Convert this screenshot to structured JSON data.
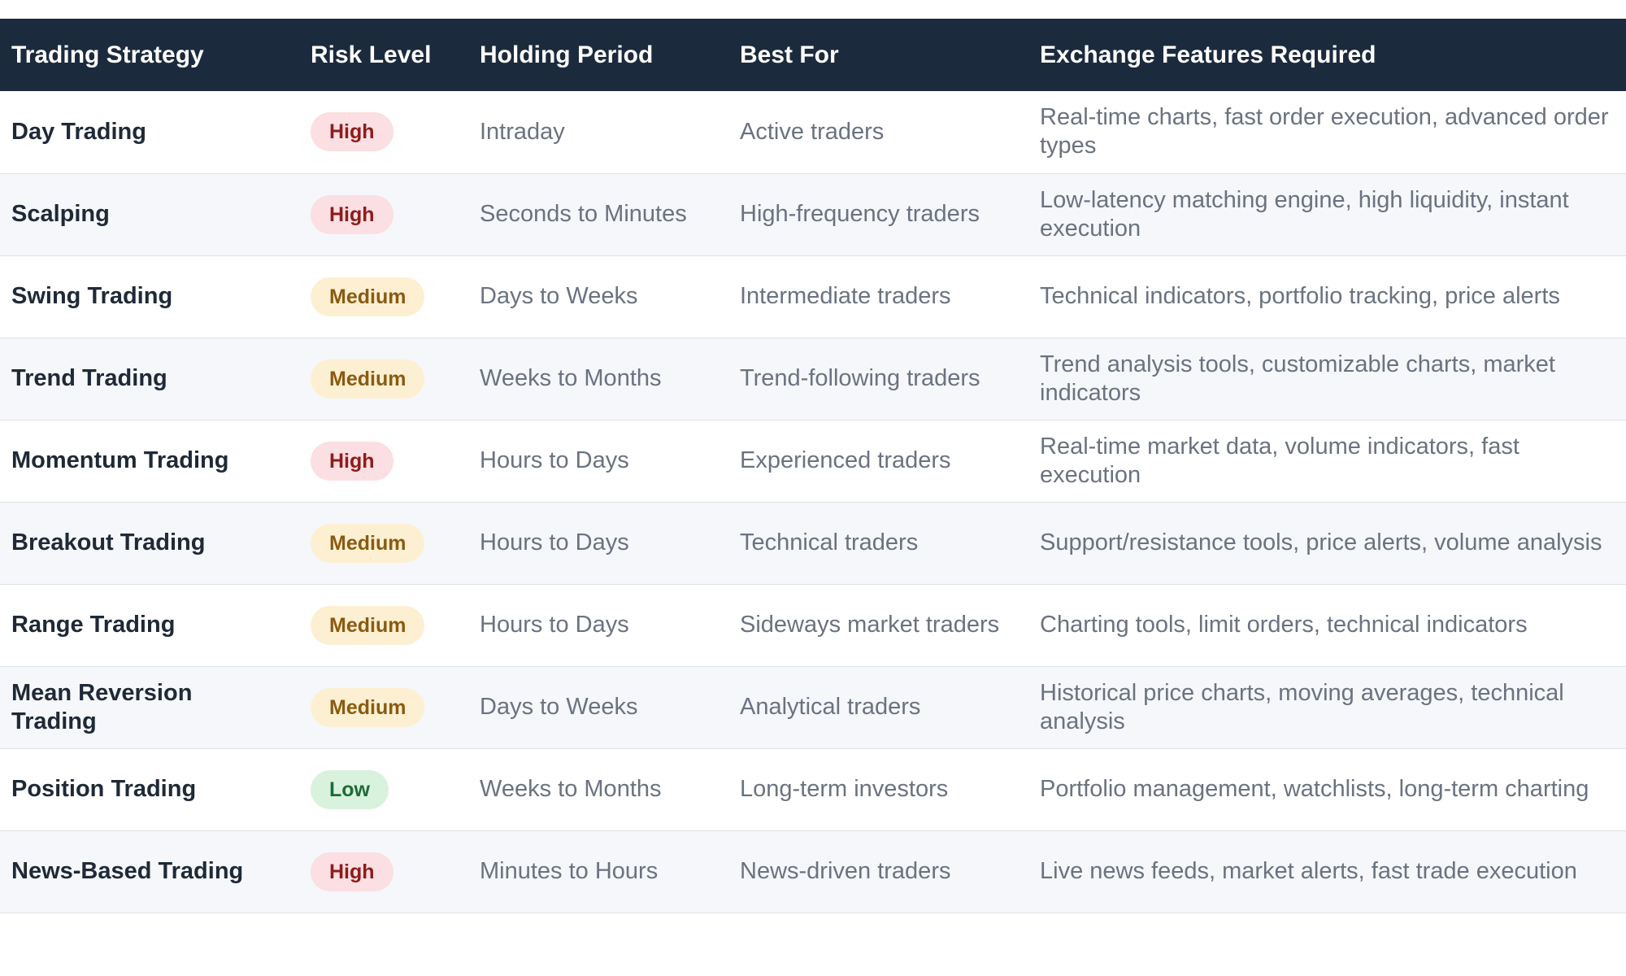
{
  "table": {
    "headers": [
      "Trading Strategy",
      "Risk Level",
      "Holding Period",
      "Best For",
      "Exchange Features Required"
    ],
    "rows": [
      {
        "strategy": "Day Trading",
        "risk": "High",
        "period": "Intraday",
        "best_for": "Active traders",
        "features": "Real-time charts, fast order execution, advanced order types"
      },
      {
        "strategy": "Scalping",
        "risk": "High",
        "period": "Seconds to Minutes",
        "best_for": "High-frequency traders",
        "features": "Low-latency matching engine, high liquidity, instant execution"
      },
      {
        "strategy": "Swing Trading",
        "risk": "Medium",
        "period": "Days to Weeks",
        "best_for": "Intermediate traders",
        "features": "Technical indicators, portfolio tracking, price alerts"
      },
      {
        "strategy": "Trend Trading",
        "risk": "Medium",
        "period": "Weeks to Months",
        "best_for": "Trend-following traders",
        "features": "Trend analysis tools, customizable charts, market indicators"
      },
      {
        "strategy": "Momentum Trading",
        "risk": "High",
        "period": "Hours to Days",
        "best_for": "Experienced traders",
        "features": "Real-time market data, volume indicators, fast execution"
      },
      {
        "strategy": "Breakout Trading",
        "risk": "Medium",
        "period": "Hours to Days",
        "best_for": "Technical traders",
        "features": "Support/resistance tools, price alerts, volume analysis"
      },
      {
        "strategy": "Range Trading",
        "risk": "Medium",
        "period": "Hours to Days",
        "best_for": "Sideways market traders",
        "features": "Charting tools, limit orders, technical indicators"
      },
      {
        "strategy": "Mean Reversion Trading",
        "risk": "Medium",
        "period": "Days to Weeks",
        "best_for": "Analytical traders",
        "features": "Historical price charts, moving averages, technical analysis"
      },
      {
        "strategy": "Position Trading",
        "risk": "Low",
        "period": "Weeks to Months",
        "best_for": "Long-term investors",
        "features": "Portfolio management, watchlists, long-term charting"
      },
      {
        "strategy": "News-Based Trading",
        "risk": "High",
        "period": "Minutes to Hours",
        "best_for": "News-driven traders",
        "features": "Live news feeds, market alerts, fast trade execution"
      }
    ]
  },
  "colors": {
    "header_bg": "#1c2a3d",
    "high_badge": "#fbdfe2",
    "medium_badge": "#fdf0d2",
    "low_badge": "#d9f2dd"
  }
}
